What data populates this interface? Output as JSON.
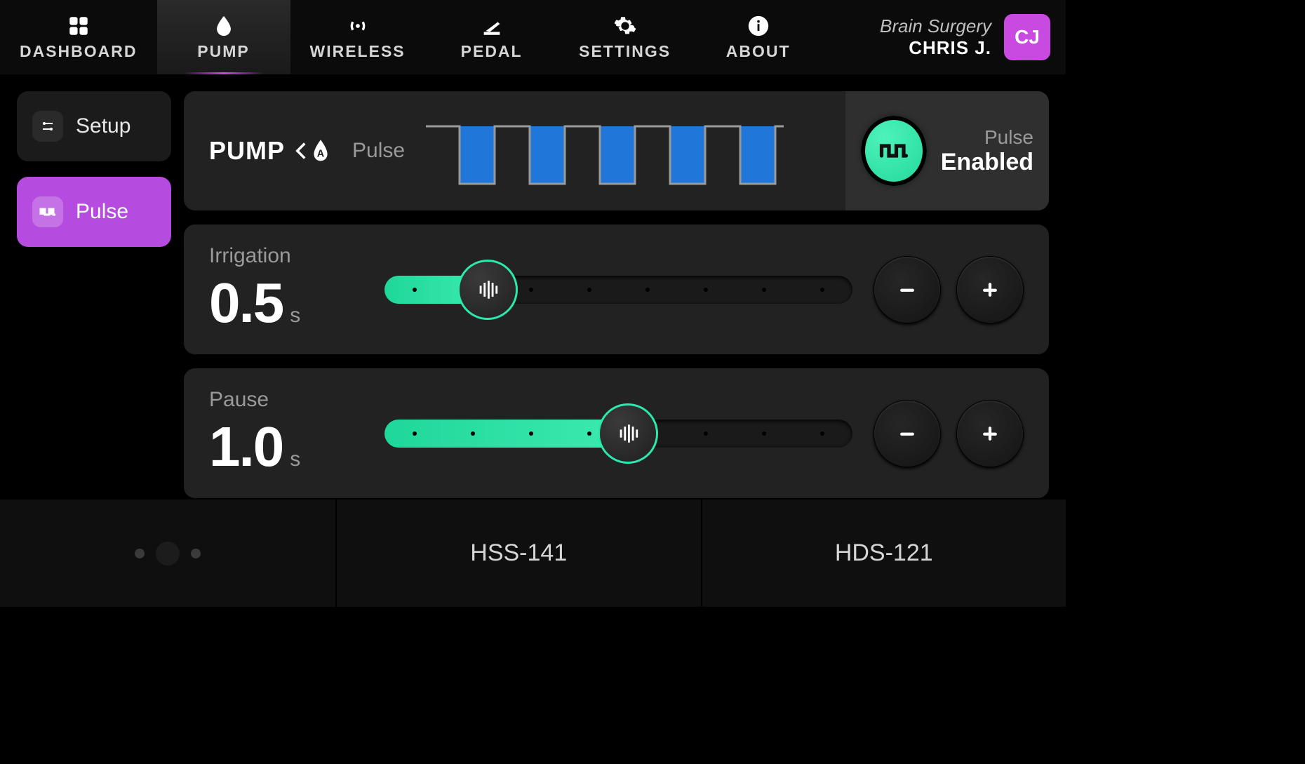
{
  "nav": {
    "items": [
      {
        "label": "DASHBOARD",
        "icon": "dashboard",
        "active": false
      },
      {
        "label": "PUMP",
        "icon": "drop",
        "active": true
      },
      {
        "label": "WIRELESS",
        "icon": "wireless",
        "active": false
      },
      {
        "label": "PEDAL",
        "icon": "pedal",
        "active": false
      },
      {
        "label": "SETTINGS",
        "icon": "gear",
        "active": false
      },
      {
        "label": "ABOUT",
        "icon": "info",
        "active": false
      }
    ]
  },
  "user": {
    "context": "Brain Surgery",
    "name": "CHRIS J.",
    "initials": "CJ"
  },
  "sidebar": {
    "items": [
      {
        "label": "Setup",
        "icon": "sliders",
        "active": false
      },
      {
        "label": "Pulse",
        "icon": "pulse",
        "active": true
      }
    ]
  },
  "pump": {
    "title": "PUMP",
    "mode": "Pulse",
    "toggle_label": "Pulse",
    "toggle_state": "Enabled"
  },
  "irrigation": {
    "label": "Irrigation",
    "value": "0.5",
    "unit": "s",
    "fill_pct": 22,
    "thumb_pct": 22
  },
  "pause": {
    "label": "Pause",
    "value": "1.0",
    "unit": "s",
    "fill_pct": 52,
    "thumb_pct": 52
  },
  "footer": {
    "items": [
      "HSS-141",
      "HDS-121"
    ]
  }
}
